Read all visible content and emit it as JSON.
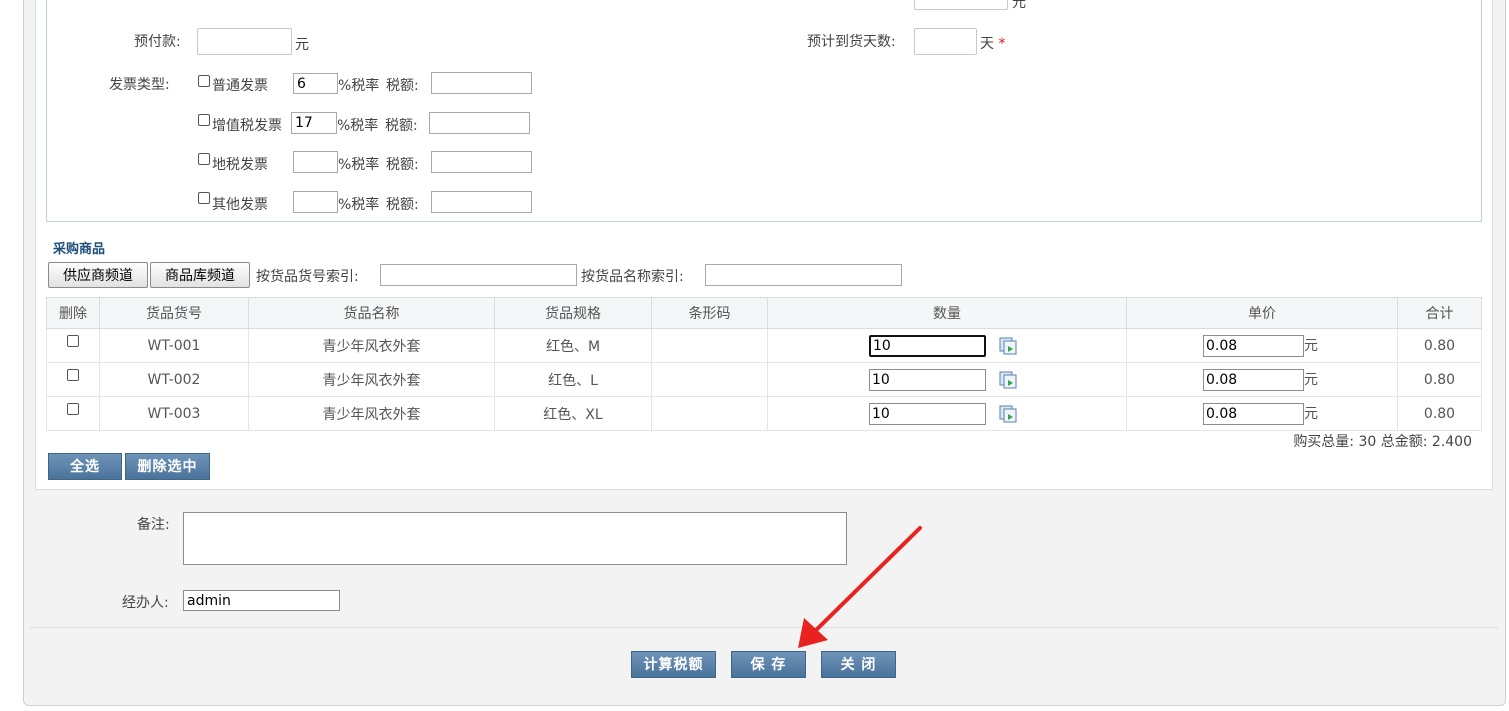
{
  "form": {
    "top_unit": "元",
    "prepay_label": "预付款:",
    "prepay_value": "",
    "prepay_unit": "元",
    "days_label": "预计到货天数:",
    "days_value": "",
    "days_unit": "天",
    "required_mark": "*",
    "invoice_label": "发票类型:",
    "rate_suffix": "%税率",
    "tax_label": "税额:",
    "invoices": [
      {
        "name": "普通发票",
        "rate": "6",
        "tax": ""
      },
      {
        "name": "增值税发票",
        "rate": "17",
        "tax": ""
      },
      {
        "name": "地税发票",
        "rate": "",
        "tax": ""
      },
      {
        "name": "其他发票",
        "rate": "",
        "tax": ""
      }
    ]
  },
  "goods": {
    "section_title": "采购商品",
    "supplier_channel_btn": "供应商频道",
    "library_channel_btn": "商品库频道",
    "code_search_label": "按货品货号索引:",
    "code_search_value": "",
    "name_search_label": "按货品名称索引:",
    "name_search_value": "",
    "columns": [
      "删除",
      "货品货号",
      "货品名称",
      "货品规格",
      "条形码",
      "数量",
      "单价",
      "合计"
    ],
    "rows": [
      {
        "code": "WT-001",
        "name": "青少年风衣外套",
        "spec": "红色、M",
        "barcode": "",
        "qty": "10",
        "price": "0.08",
        "unit": "元",
        "total": "0.80"
      },
      {
        "code": "WT-002",
        "name": "青少年风衣外套",
        "spec": "红色、L",
        "barcode": "",
        "qty": "10",
        "price": "0.08",
        "unit": "元",
        "total": "0.80"
      },
      {
        "code": "WT-003",
        "name": "青少年风衣外套",
        "spec": "红色、XL",
        "barcode": "",
        "qty": "10",
        "price": "0.08",
        "unit": "元",
        "total": "0.80"
      }
    ],
    "summary": "购买总量: 30 总金额: 2.400",
    "select_all_btn": "全选",
    "delete_selected_btn": "删除选中"
  },
  "notes": {
    "label": "备注:",
    "value": ""
  },
  "handler": {
    "label": "经办人:",
    "value": "admin"
  },
  "actions": {
    "calc_tax": "计算税额",
    "save": "保 存",
    "close": "关 闭"
  },
  "colors": {
    "blue_button": "#4f789f",
    "section_title": "#1d4f7b",
    "required": "#e2141b",
    "arrow": "#e8231f"
  },
  "icons": {
    "row_copy": "copy-fill-icon",
    "annotation": "red-arrow"
  }
}
